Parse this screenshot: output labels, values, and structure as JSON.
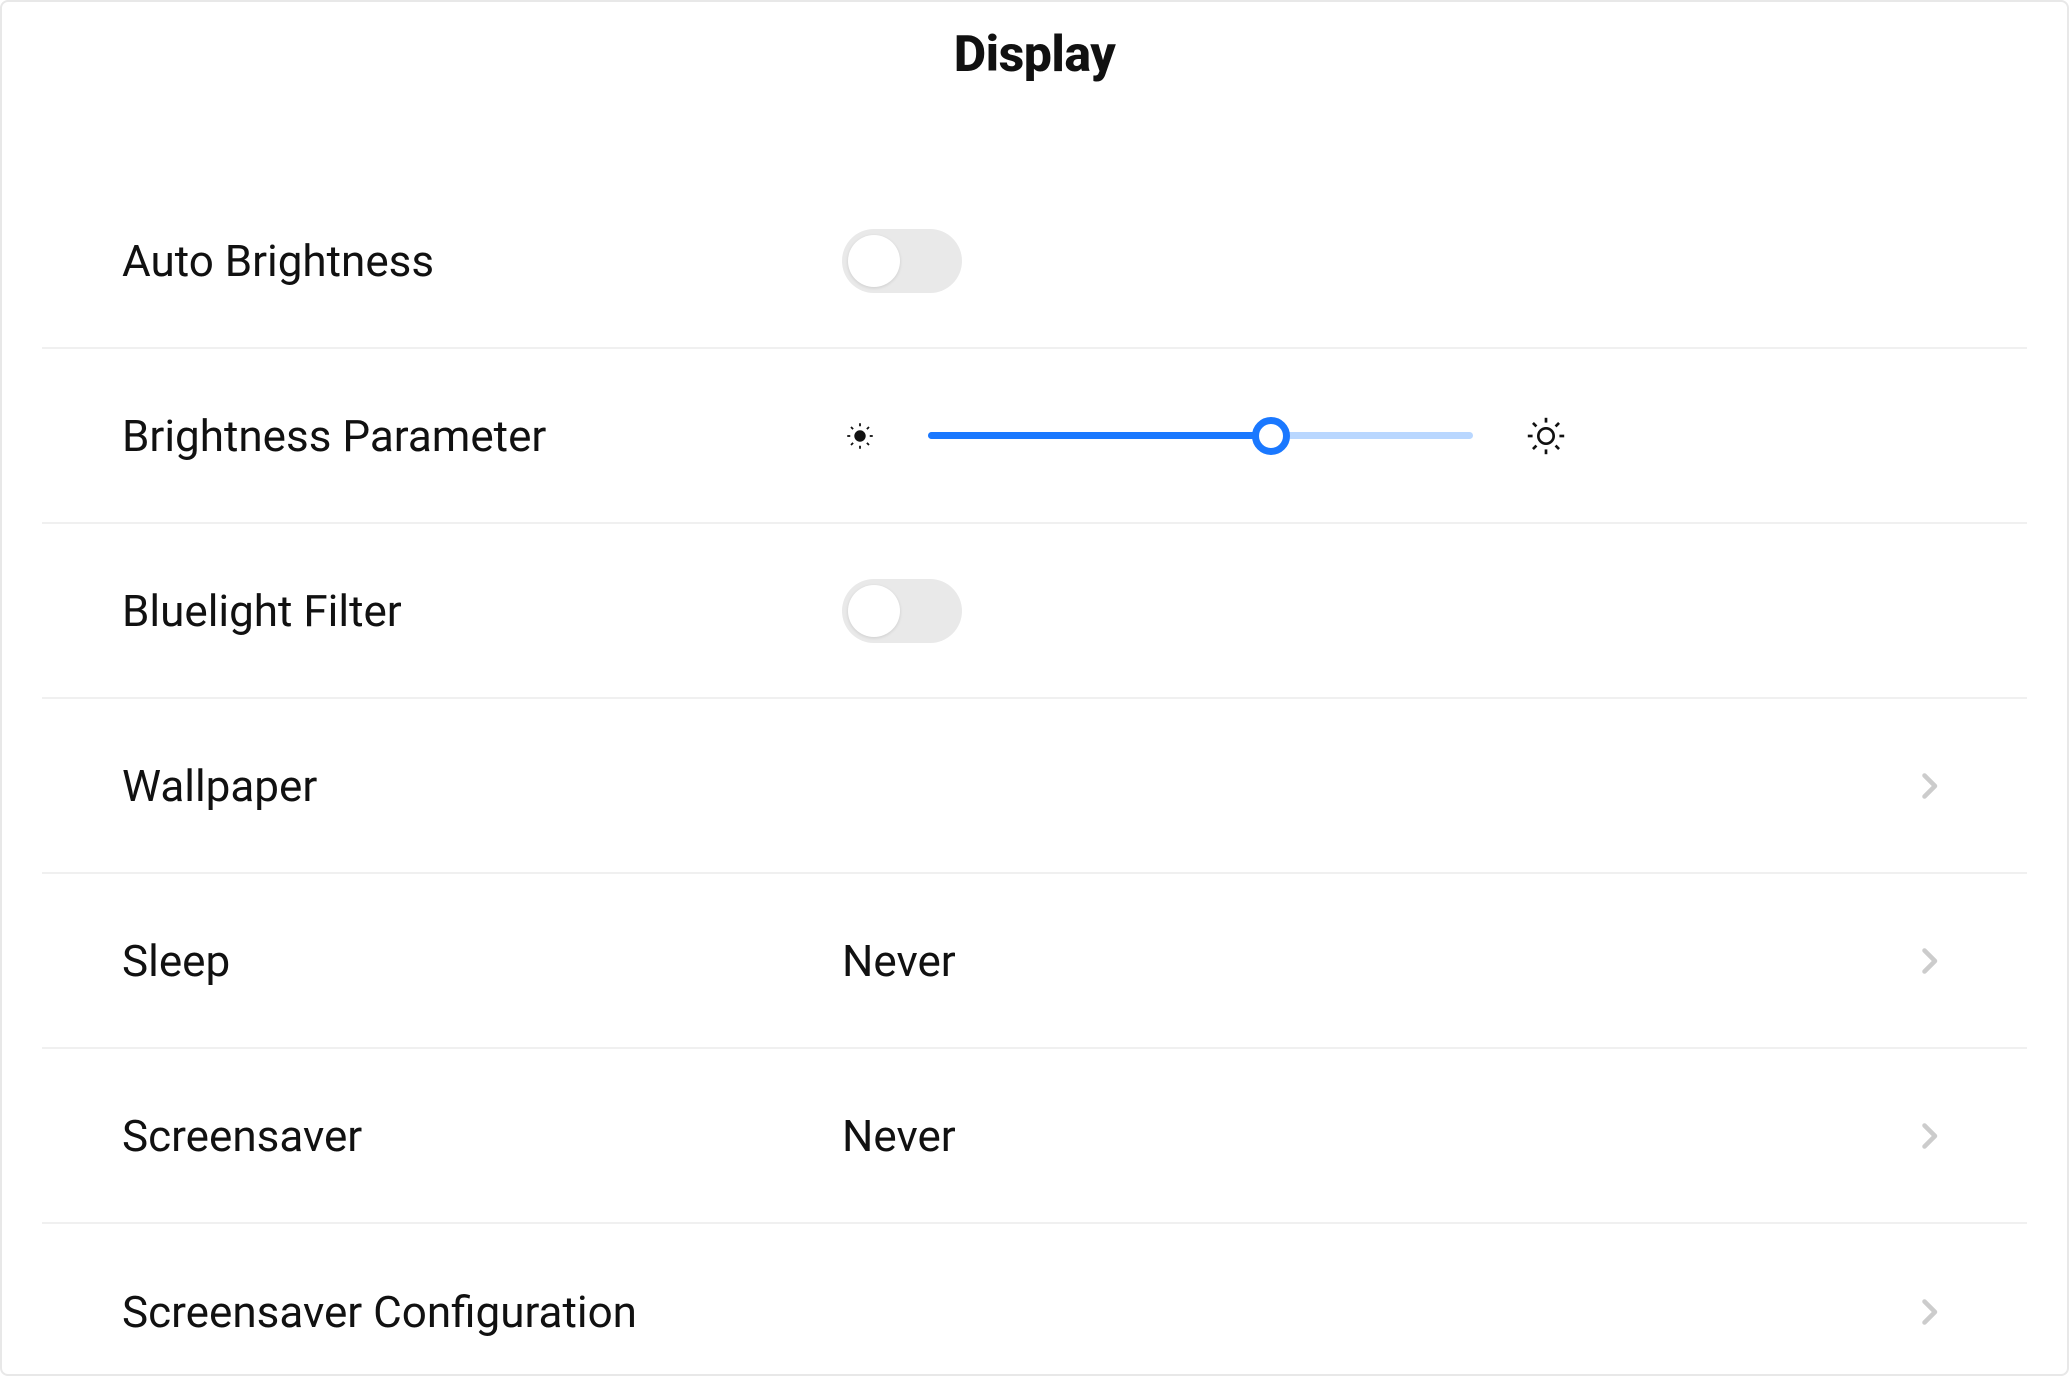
{
  "title": "Display",
  "rows": {
    "autoBrightness": {
      "label": "Auto Brightness",
      "on": false
    },
    "brightness": {
      "label": "Brightness Parameter",
      "percent": 63
    },
    "bluelight": {
      "label": "Bluelight Filter",
      "on": false
    },
    "wallpaper": {
      "label": "Wallpaper"
    },
    "sleep": {
      "label": "Sleep",
      "value": "Never"
    },
    "screensaver": {
      "label": "Screensaver",
      "value": "Never"
    },
    "screensaverConfig": {
      "label": "Screensaver Configuration"
    }
  },
  "colors": {
    "accent": "#1a78ff",
    "track": "#b9d7ff",
    "toggleOff": "#e9e9e9",
    "divider": "#f0f0f0",
    "chevron": "#cccccc"
  }
}
